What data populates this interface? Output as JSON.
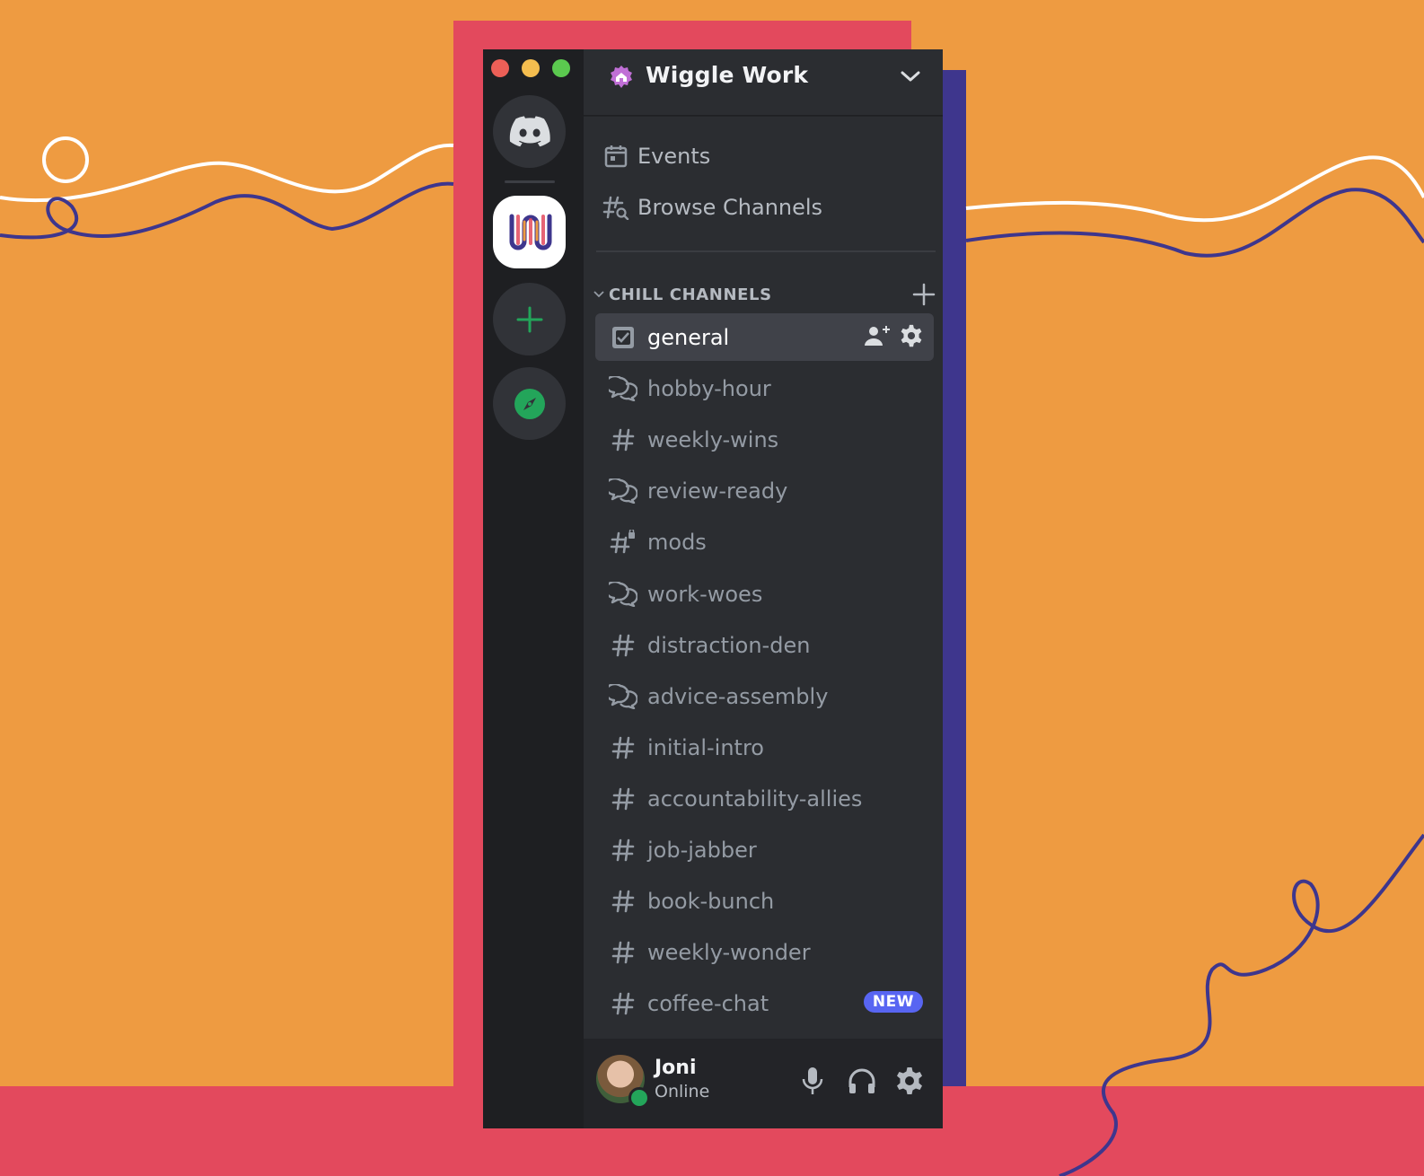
{
  "server": {
    "name": "Wiggle Work",
    "nav": [
      {
        "label": "Events",
        "icon": "calendar-icon"
      },
      {
        "label": "Browse Channels",
        "icon": "browse-channels-icon"
      }
    ],
    "category": {
      "label": "CHILL CHANNELS"
    },
    "channels": [
      {
        "label": "general",
        "icon": "rules-channel-icon",
        "selected": true
      },
      {
        "label": "hobby-hour",
        "icon": "forum-icon"
      },
      {
        "label": "weekly-wins",
        "icon": "hashtag-icon"
      },
      {
        "label": "review-ready",
        "icon": "forum-icon"
      },
      {
        "label": "mods",
        "icon": "locked-hashtag-icon"
      },
      {
        "label": "work-woes",
        "icon": "forum-icon"
      },
      {
        "label": "distraction-den",
        "icon": "hashtag-icon"
      },
      {
        "label": "advice-assembly",
        "icon": "forum-icon"
      },
      {
        "label": "initial-intro",
        "icon": "hashtag-icon"
      },
      {
        "label": "accountability-allies",
        "icon": "hashtag-icon"
      },
      {
        "label": "job-jabber",
        "icon": "hashtag-icon"
      },
      {
        "label": "book-bunch",
        "icon": "hashtag-icon"
      },
      {
        "label": "weekly-wonder",
        "icon": "hashtag-icon"
      },
      {
        "label": "coffee-chat",
        "icon": "hashtag-icon",
        "badge": "NEW"
      }
    ]
  },
  "user": {
    "name": "Joni",
    "status": "Online"
  },
  "colors": {
    "background": "#ee9b41",
    "accent_red": "#e3495d",
    "accent_purple": "#3e368d",
    "rail": "#1e1f22",
    "panel": "#2b2d31",
    "selected": "#404249",
    "brand": "#5865f2",
    "online": "#23a55a"
  }
}
